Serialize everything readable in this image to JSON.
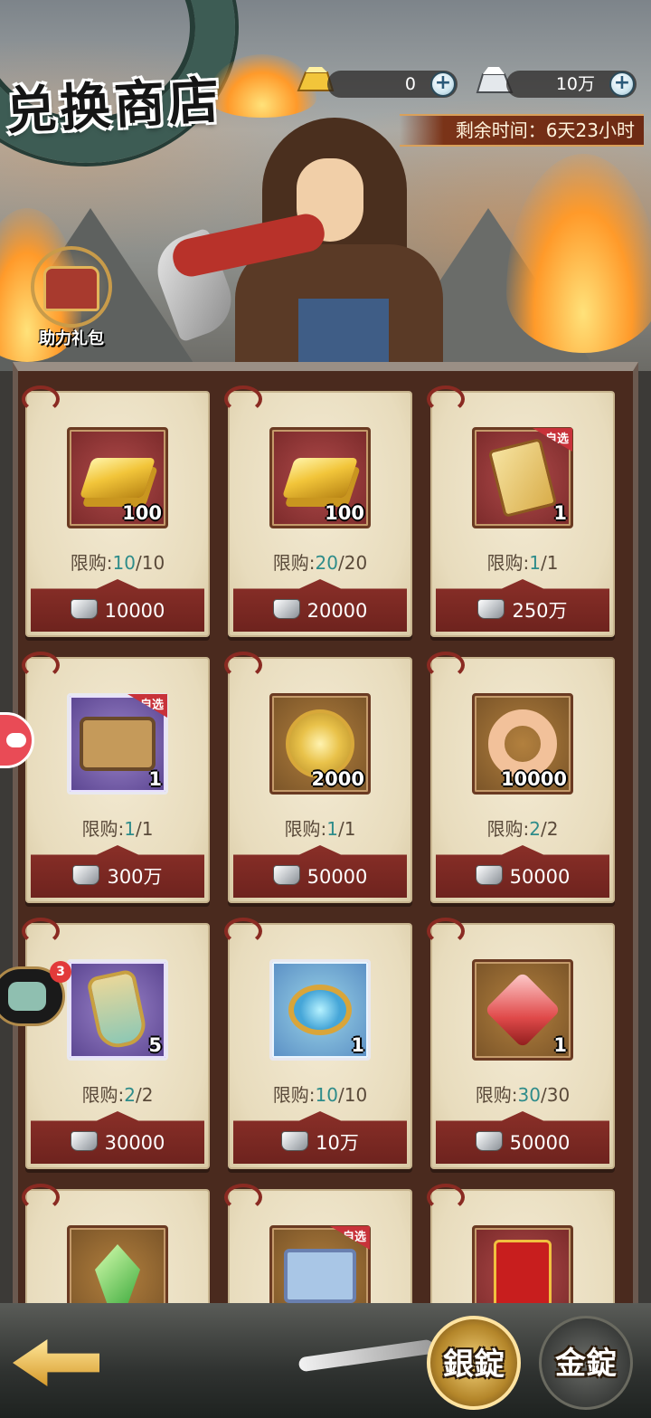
{
  "header": {
    "title": "兑换商店",
    "currencies": [
      {
        "name": "gold-ingot",
        "value": "0"
      },
      {
        "name": "silver-ingot",
        "value": "10万"
      }
    ],
    "plus_label": "+",
    "timer": "剩余时间：6天23小时"
  },
  "gift": {
    "label": "助力礼包"
  },
  "limit_label": "限购:",
  "items": [
    {
      "icon": "gold-bar-icon",
      "qty": "100",
      "bought": "10",
      "limit": "/10",
      "price": "10000",
      "tag": ""
    },
    {
      "icon": "gold-bar-icon",
      "qty": "100",
      "bought": "20",
      "limit": "/20",
      "price": "20000",
      "tag": ""
    },
    {
      "icon": "skill-book-icon",
      "qty": "1",
      "bought": "1",
      "limit": "/1",
      "price": "250万",
      "tag": "自选"
    },
    {
      "icon": "treasure-chest-icon",
      "qty": "1",
      "bought": "1",
      "limit": "/1",
      "price": "300万",
      "tag": "自选"
    },
    {
      "icon": "gold-coin-icon",
      "qty": "2000",
      "bought": "1",
      "limit": "/1",
      "price": "50000",
      "tag": ""
    },
    {
      "icon": "jade-ring-icon",
      "qty": "10000",
      "bought": "2",
      "limit": "/2",
      "price": "50000",
      "tag": ""
    },
    {
      "icon": "token-icon",
      "qty": "5",
      "bought": "2",
      "limit": "/2",
      "price": "30000",
      "tag": ""
    },
    {
      "icon": "orb-icon",
      "qty": "1",
      "bought": "10",
      "limit": "/10",
      "price": "10万",
      "tag": ""
    },
    {
      "icon": "red-gem-icon",
      "qty": "1",
      "bought": "30",
      "limit": "/30",
      "price": "50000",
      "tag": ""
    },
    {
      "icon": "green-crystal-icon",
      "qty": "",
      "bought": "",
      "limit": "",
      "price": "",
      "tag": ""
    },
    {
      "icon": "crystal-crate-icon",
      "qty": "",
      "bought": "",
      "limit": "",
      "price": "",
      "tag": "自选"
    },
    {
      "icon": "red-envelope-icon",
      "qty": "",
      "bought": "",
      "limit": "",
      "price": "",
      "tag": ""
    }
  ],
  "chat": {
    "badge": "3"
  },
  "tabs": {
    "silver": "銀錠",
    "gold": "金錠"
  },
  "colors": {
    "limit_count": "#2e8c8a",
    "price_band": "#8a2f28",
    "tag": "#c8323a"
  }
}
